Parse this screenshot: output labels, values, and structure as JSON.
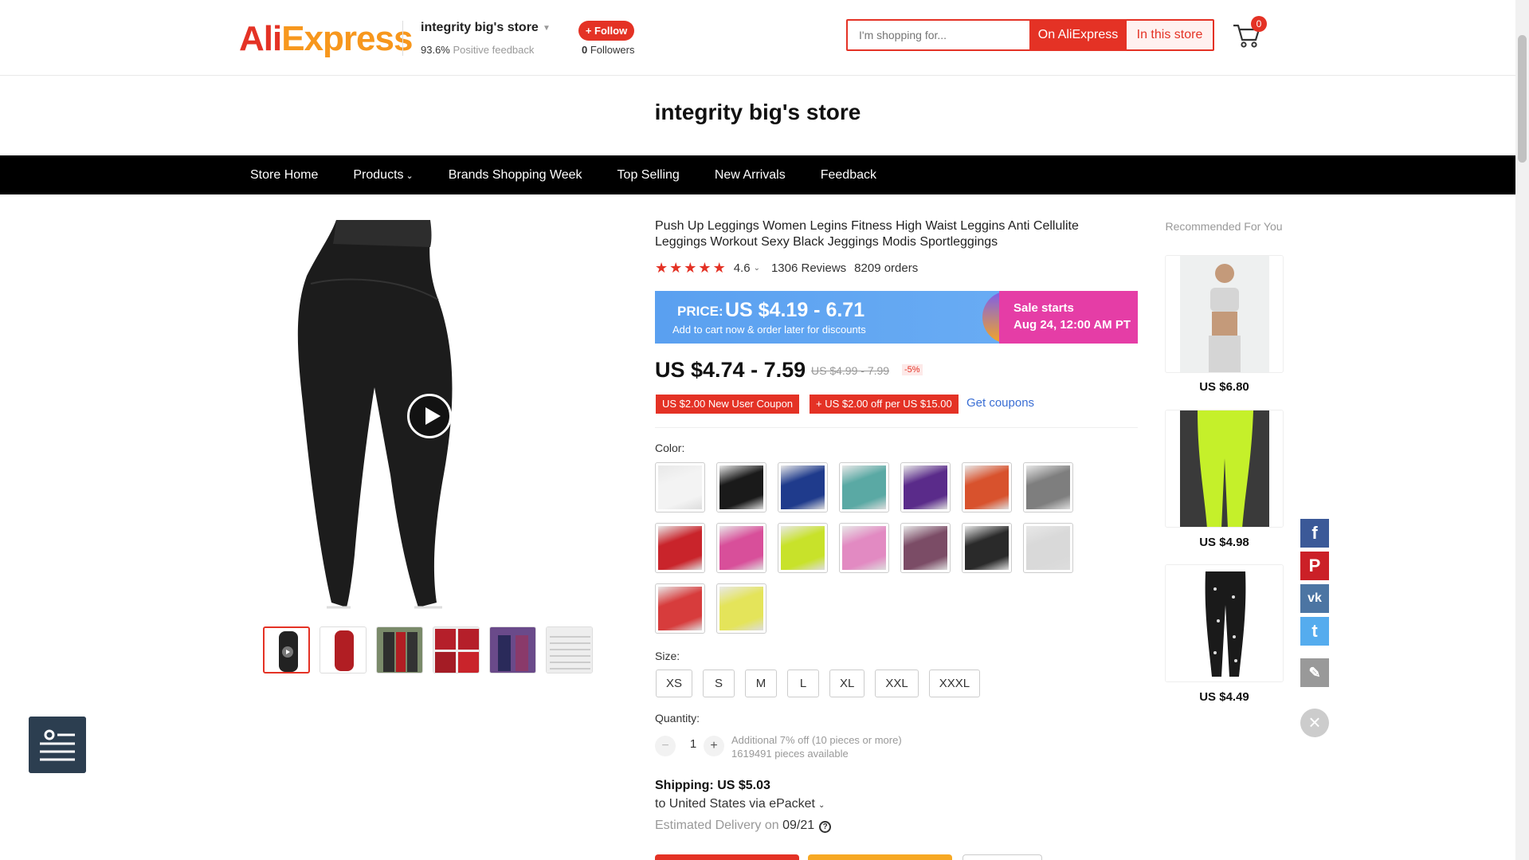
{
  "header": {
    "logo": "AliExpress",
    "logo_part1": "Ali",
    "logo_part2": "Express",
    "store_name": "integrity big's store",
    "feedback_pct": "93.6%",
    "feedback_label": "Positive feedback",
    "follow_label": "+ Follow",
    "followers_count": "0",
    "followers_label": "Followers",
    "search_placeholder": "I'm shopping for...",
    "search_ali_label": "On AliExpress",
    "search_store_label": "In this store",
    "cart_count": "0"
  },
  "store_title": "integrity big's store",
  "nav": {
    "items": [
      "Store Home",
      "Products",
      "Brands Shopping Week",
      "Top Selling",
      "New Arrivals",
      "Feedback"
    ]
  },
  "product": {
    "title": "Push Up Leggings Women Legins Fitness High Waist Leggins Anti Cellulite Leggings Workout Sexy Black Jeggings Modis Sportleggings",
    "rating": "4.6",
    "stars": 5,
    "reviews": "1306 Reviews",
    "orders": "8209 orders",
    "promo_price_label": "PRICE:",
    "promo_price": "US $4.19 - 6.71",
    "promo_sub": "Add to cart now & order later for discounts",
    "sale_line1": "Sale starts",
    "sale_line2": "Aug 24, 12:00 AM PT",
    "price": "US $4.74 - 7.59",
    "old_price": "US $4.99 - 7.99",
    "discount": "-5%",
    "coupon1": "US $2.00 New User Coupon",
    "coupon2": "+ US $2.00 off per US $15.00",
    "get_coupons": "Get coupons",
    "color_label": "Color:",
    "size_label": "Size:",
    "sizes": [
      "XS",
      "S",
      "M",
      "L",
      "XL",
      "XXL",
      "XXXL"
    ],
    "quantity_label": "Quantity:",
    "quantity": "1",
    "qty_note1": "Additional 7% off (10 pieces or more)",
    "qty_note2": "1619491 pieces available",
    "shipping_title": "Shipping: US $5.03",
    "shipping_to": "to United States via ePacket",
    "delivery_label": "Estimated Delivery on",
    "delivery_date": "09/21"
  },
  "swatch_colors": [
    "#f3f3f3",
    "#1a1a1a",
    "#1f3b8c",
    "#5aa9a4",
    "#5a2b8a",
    "#d8522d",
    "#7e7e7e",
    "#c9242b",
    "#d84f9a",
    "#c8e22a",
    "#e28ac2",
    "#7b4c66",
    "#2a2a2a",
    "#d9d9d9",
    "#d73c3c",
    "#e4e45a"
  ],
  "thumb_colors": [
    "#222",
    "#b11e23",
    "#2e2e2e",
    "#b51f2a",
    "#6a4a8a",
    "#eeeeee"
  ],
  "recommended": {
    "title": "Recommended For You",
    "items": [
      {
        "price": "US $6.80",
        "color": "#d5d5d5"
      },
      {
        "price": "US $4.98",
        "color": "#c5f02a"
      },
      {
        "price": "US $4.49",
        "color": "#1a1a1a"
      }
    ]
  },
  "share": {
    "facebook": "f",
    "pinterest": "P",
    "vk": "vk",
    "twitter": "t",
    "facebook_color": "#3b5998",
    "pinterest_color": "#cb2027",
    "vk_color": "#4c75a3",
    "twitter_color": "#55acee"
  },
  "colors": {
    "accent": "#e43225",
    "promo_blue": "#5aa0f0",
    "sale_pink": "#e53da6"
  }
}
